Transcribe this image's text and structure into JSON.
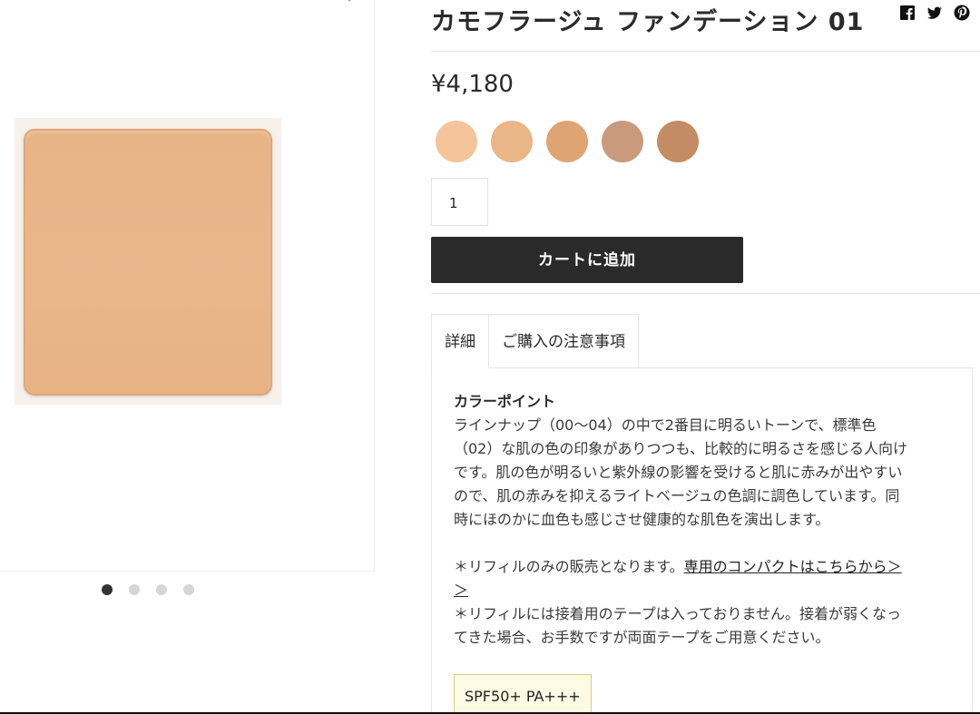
{
  "product": {
    "title": "カモフラージュ ファンデーション 01",
    "price": "¥4,180",
    "quantity": "1",
    "add_to_cart_label": "カートに追加"
  },
  "share_icons": [
    "facebook-icon",
    "twitter-icon",
    "pinterest-icon"
  ],
  "color_options": [
    {
      "name": "shade-00",
      "color": "#f5c49b"
    },
    {
      "name": "shade-01",
      "color": "#eab587"
    },
    {
      "name": "shade-02",
      "color": "#dea474"
    },
    {
      "name": "shade-03",
      "color": "#c99a7c"
    },
    {
      "name": "shade-04",
      "color": "#c48c63"
    }
  ],
  "gallery": {
    "slide_count": 4,
    "active_slide": 1,
    "product_color": "#e8b386"
  },
  "tabs": [
    {
      "label": "詳細",
      "active": true
    },
    {
      "label": "ご購入の注意事項",
      "active": false
    }
  ],
  "details": {
    "heading": "カラーポイント",
    "lines": [
      "ラインナップ（00〜04）の中で2番目に明るいトーンで、標準色",
      "（02）な肌の色の印象がありつつも、比較的に明るさを感じる人向け",
      "です。肌の色が明るいと紫外線の影響を受けると肌に赤みが出やすい",
      "ので、肌の赤みを抑えるライトベージュの色調に調色しています。同",
      "時にほのかに血色も感じさせ健康的な肌色を演出します。"
    ],
    "refill_note": "＊リフィルのみの販売となります。",
    "compact_link_line1": "専用のコンパクトはこちらから＞",
    "compact_link_line2": "＞",
    "tape_line1": "＊リフィルには接着用のテープは入っておりません。接着が弱くなっ",
    "tape_line2": "てきた場合、お手数ですが両面テープをご用意ください。",
    "spf_badge": "SPF50+ PA+++"
  }
}
